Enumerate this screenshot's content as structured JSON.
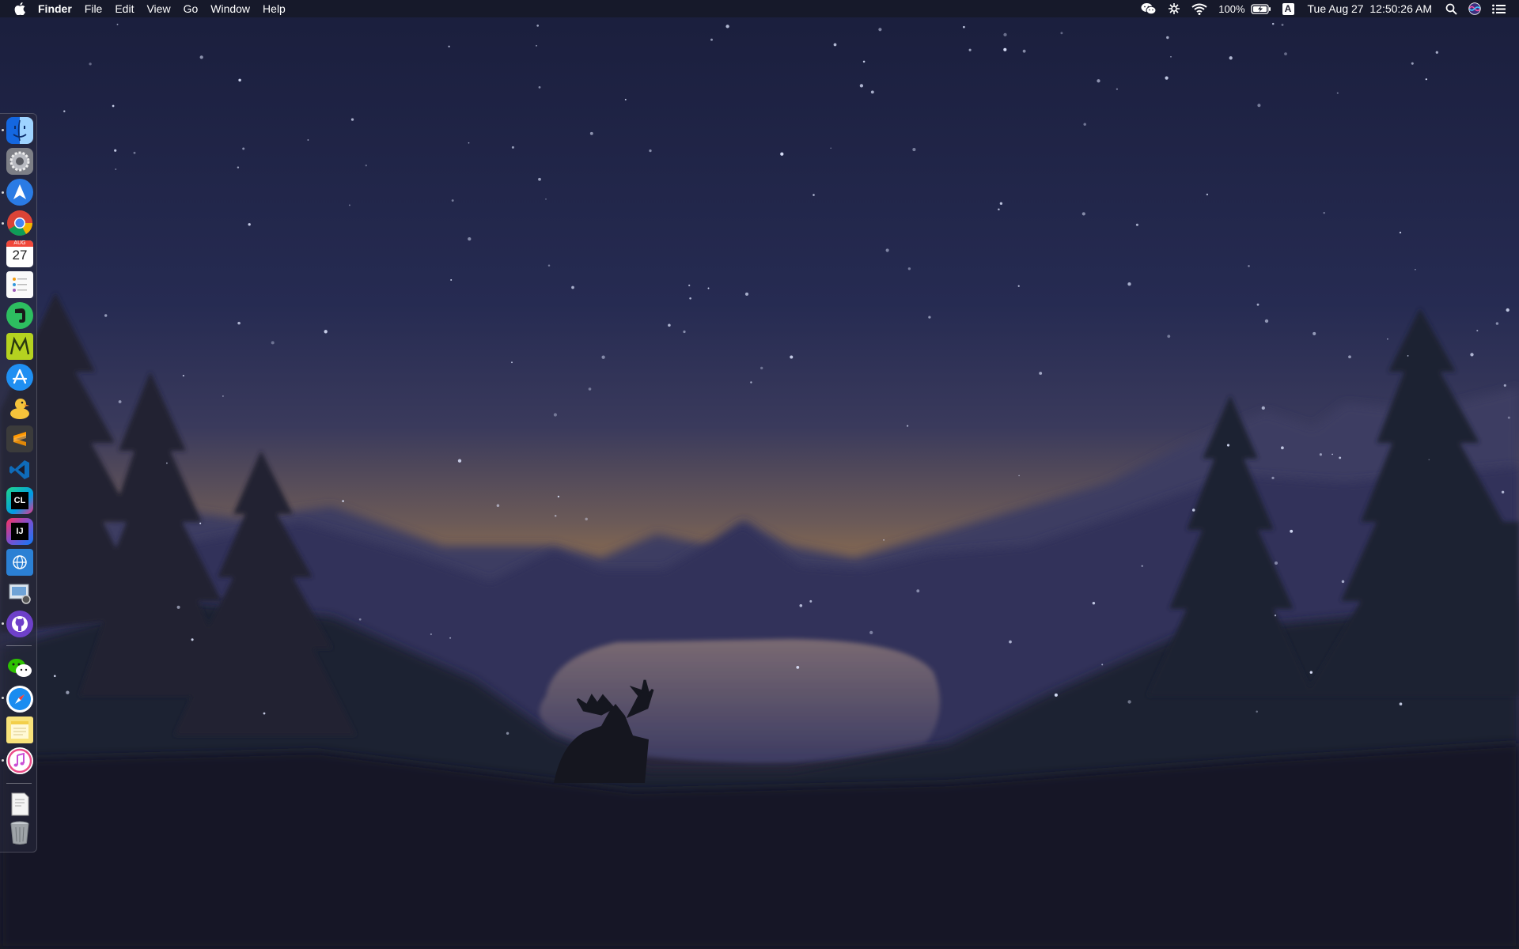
{
  "menubar": {
    "apple_icon": "apple-logo-icon",
    "app_name": "Finder",
    "menus": [
      "File",
      "Edit",
      "View",
      "Go",
      "Window",
      "Help"
    ],
    "status": {
      "wechat_icon": "wechat-icon",
      "extension_icon": "extension-icon",
      "wifi_icon": "wifi-icon",
      "battery_percent": "100%",
      "battery_icon": "battery-charging-icon",
      "input_source": "A",
      "datetime": "Tue Aug 27  12:50:26 AM",
      "spotlight_icon": "spotlight-search-icon",
      "siri_icon": "siri-icon",
      "notification_icon": "notification-center-icon"
    }
  },
  "dock": {
    "orientation": "left",
    "calendar_day": "27",
    "calendar_month": "AUG",
    "apps": [
      {
        "name": "Finder",
        "icon": "finder-icon",
        "color": "#1e8ef0"
      },
      {
        "name": "System Preferences",
        "icon": "gear-icon",
        "color": "#8a8a90"
      },
      {
        "name": "Spark",
        "icon": "paper-plane-icon",
        "color": "#2a7be4"
      },
      {
        "name": "Google Chrome",
        "icon": "chrome-icon",
        "color": "#f2f2f2"
      },
      {
        "name": "Calendar",
        "icon": "calendar-icon",
        "color": "#ffffff"
      },
      {
        "name": "Reminders",
        "icon": "reminders-icon",
        "color": "#ffffff"
      },
      {
        "name": "Evernote",
        "icon": "evernote-icon",
        "color": "#2dbe60"
      },
      {
        "name": "Mindnode",
        "icon": "mindnode-icon",
        "color": "#b5d220"
      },
      {
        "name": "App Store",
        "icon": "app-store-icon",
        "color": "#1f8ff2"
      },
      {
        "name": "Cyberduck",
        "icon": "duck-icon",
        "color": "#f5c33b"
      },
      {
        "name": "Sublime Text",
        "icon": "sublime-icon",
        "color": "#3b3b3b"
      },
      {
        "name": "Visual Studio Code",
        "icon": "vscode-icon",
        "color": "#0f6bb8"
      },
      {
        "name": "CLion",
        "icon": "clion-icon",
        "color": "#21d789"
      },
      {
        "name": "IntelliJ IDEA",
        "icon": "intellij-icon",
        "color": "#fe315d"
      },
      {
        "name": "Network Utility",
        "icon": "globe-doc-icon",
        "color": "#2b80d4"
      },
      {
        "name": "Preview",
        "icon": "preview-icon",
        "color": "#9aa7b5"
      },
      {
        "name": "GitHub Desktop",
        "icon": "github-icon",
        "color": "#6e40c9"
      },
      {
        "name": "WeChat",
        "icon": "wechat-icon",
        "color": "#2dc100"
      },
      {
        "name": "Safari",
        "icon": "compass-icon",
        "color": "#1a8cf0"
      },
      {
        "name": "Notes",
        "icon": "notes-icon",
        "color": "#f8e27a"
      },
      {
        "name": "iTunes",
        "icon": "music-note-icon",
        "color": "#ea4c89"
      },
      {
        "name": "Document",
        "icon": "document-icon",
        "color": "#f4f4f4"
      },
      {
        "name": "Trash",
        "icon": "trash-icon",
        "color": "#9ea3a8"
      }
    ]
  }
}
